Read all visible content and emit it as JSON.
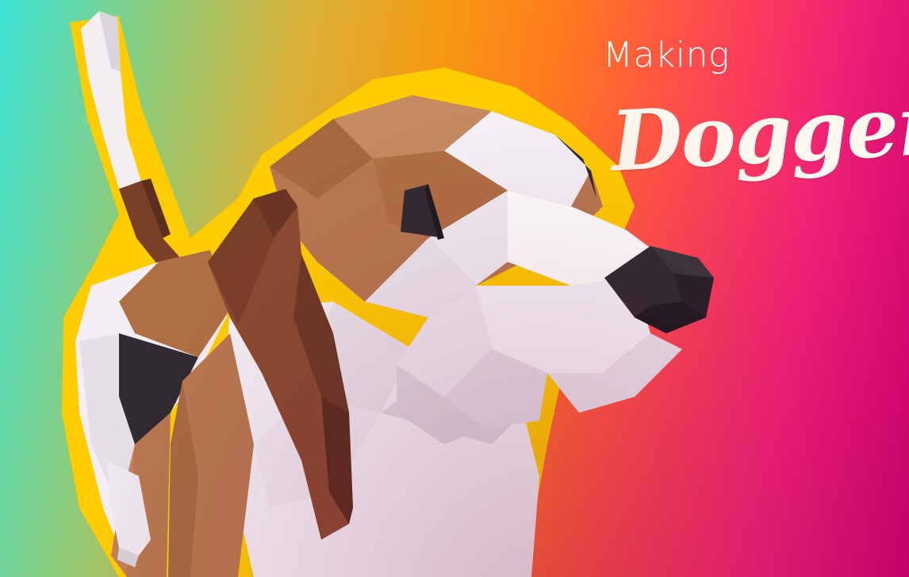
{
  "title": {
    "line1": "Making",
    "line2": "Dogger"
  },
  "illustration": {
    "subject": "low-poly-beagle",
    "colors": {
      "outline": "#ffcc00",
      "brown": "#b8784f",
      "dark_brown": "#6b3a25",
      "white": "#f4f0f3",
      "black": "#2f2b30"
    }
  }
}
